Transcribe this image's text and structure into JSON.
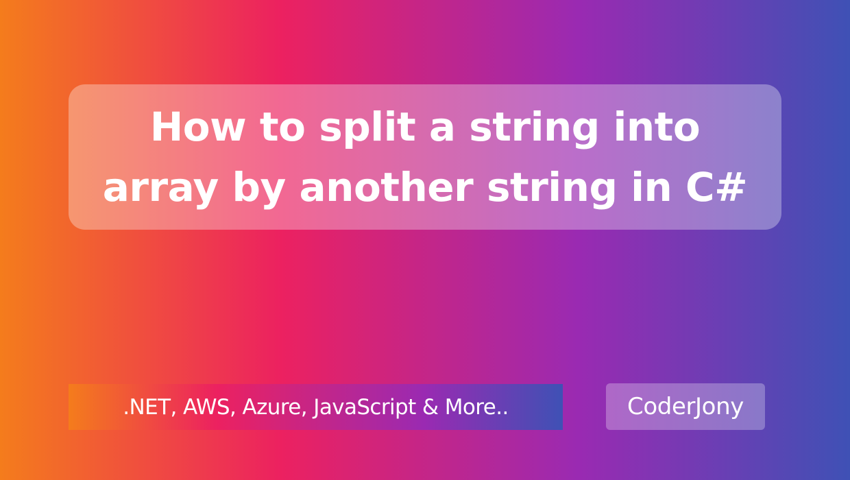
{
  "title": {
    "line1": "How to split a string into",
    "line2": "array by another string in C#"
  },
  "tagline": ".NET, AWS, Azure, JavaScript & More..",
  "brand": "CoderJony",
  "colors": {
    "gradient_start": "#f47c1c",
    "gradient_mid_pink": "#ec2160",
    "gradient_mid_purple": "#9a2ab2",
    "gradient_end": "#3f51b5",
    "text": "#ffffff"
  }
}
